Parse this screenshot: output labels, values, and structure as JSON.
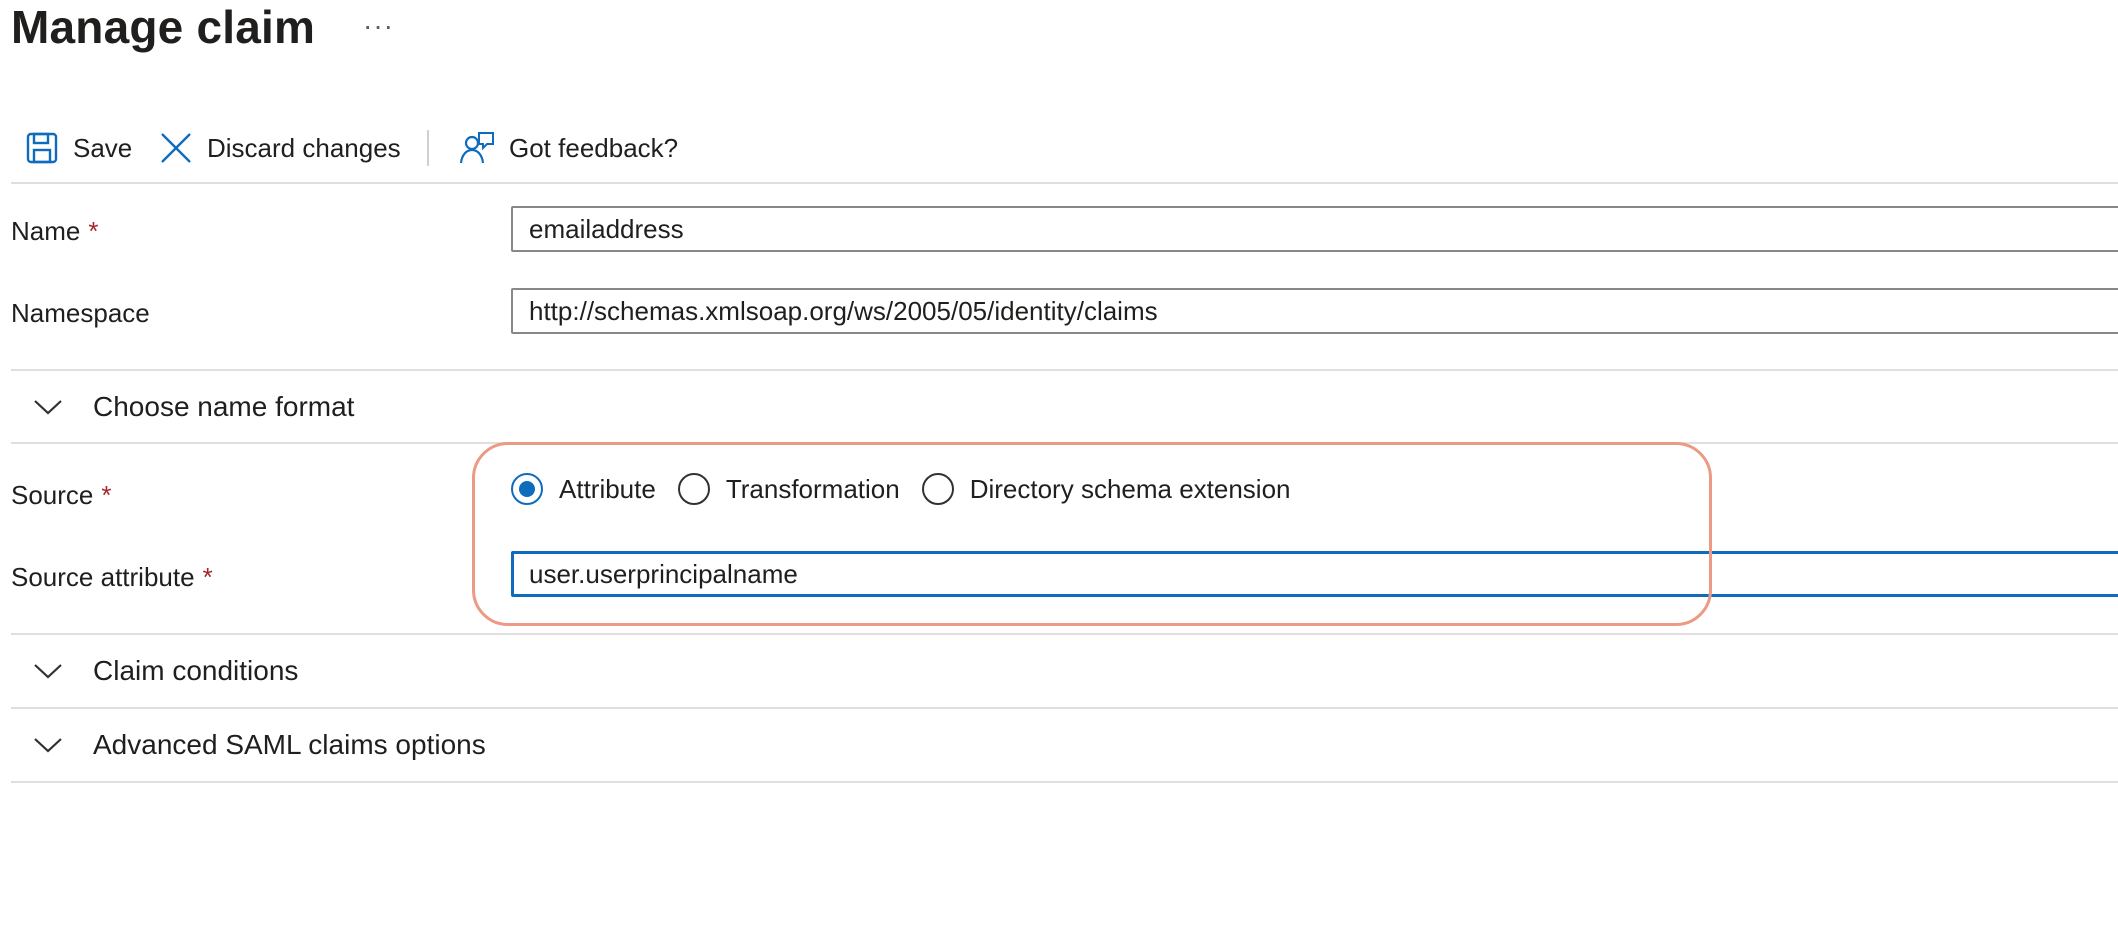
{
  "header": {
    "title": "Manage claim",
    "more": "···"
  },
  "toolbar": {
    "save_label": "Save",
    "discard_label": "Discard changes",
    "feedback_label": "Got feedback?"
  },
  "form": {
    "name": {
      "label": "Name",
      "required_mark": "*",
      "value": "emailaddress"
    },
    "namespace": {
      "label": "Namespace",
      "value": "http://schemas.xmlsoap.org/ws/2005/05/identity/claims"
    },
    "choose_name_format": {
      "label": "Choose name format"
    },
    "source": {
      "label": "Source",
      "required_mark": "*",
      "options": [
        {
          "label": "Attribute",
          "checked": true
        },
        {
          "label": "Transformation",
          "checked": false
        },
        {
          "label": "Directory schema extension",
          "checked": false
        }
      ]
    },
    "source_attribute": {
      "label": "Source attribute",
      "required_mark": "*",
      "value": "user.userprincipalname"
    },
    "claim_conditions": {
      "label": "Claim conditions"
    },
    "advanced_saml": {
      "label": "Advanced SAML claims options"
    }
  },
  "colors": {
    "accent": "#0f6cbd",
    "required": "#a4262c",
    "highlight_outline": "#ec9a85",
    "divider": "#e1dfdd"
  },
  "icons": {
    "save": "save-icon",
    "discard": "close-icon",
    "feedback": "feedback-icon",
    "chevron": "chevron-down-icon"
  }
}
